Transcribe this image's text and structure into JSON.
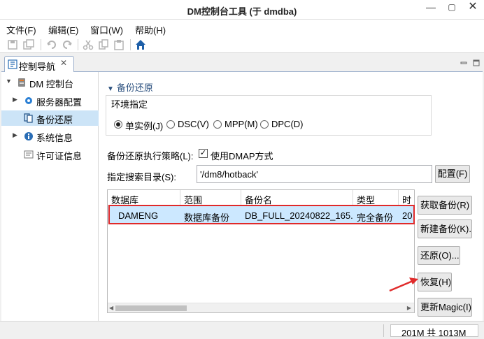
{
  "window": {
    "title": "DM控制台工具 (于 dmdba)",
    "controls": {
      "minimize": "—",
      "maximize": "▢",
      "close": "✕"
    }
  },
  "menu": {
    "items": [
      "文件(F)",
      "编辑(E)",
      "窗口(W)",
      "帮助(H)"
    ]
  },
  "toolbar": {
    "icons": [
      "save-icon",
      "save-all-icon",
      "undo-icon",
      "redo-icon",
      "cut-icon",
      "copy-icon",
      "paste-icon",
      "home-icon"
    ],
    "home_color": "#1e5fa8"
  },
  "nav_tab": {
    "label": "控制导航",
    "close": "✕"
  },
  "tree": {
    "root": "DM 控制台",
    "items": [
      {
        "label": "服务器配置",
        "icon": "gear-icon",
        "expandable": true
      },
      {
        "label": "备份还原",
        "icon": "backup-icon",
        "expandable": false,
        "selected": true
      },
      {
        "label": "系统信息",
        "icon": "info-icon",
        "expandable": true
      },
      {
        "label": "许可证信息",
        "icon": "license-icon",
        "expandable": false
      }
    ]
  },
  "main": {
    "section_title": "备份还原",
    "env_label": "环境指定",
    "env_options": [
      {
        "label": "单实例(J)",
        "selected": true
      },
      {
        "label": "DSC(V)",
        "selected": false
      },
      {
        "label": "MPP(M)",
        "selected": false
      },
      {
        "label": "DPC(D)",
        "selected": false
      }
    ],
    "strategy_label": "备份还原执行策略(L):",
    "strategy_option": "使用DMAP方式",
    "strategy_checked": true,
    "dir_label": "指定搜索目录(S):",
    "dir_value": "'/dm8/hotback'",
    "config_button": "配置(F)"
  },
  "table": {
    "columns": [
      "数据库",
      "范围",
      "备份名",
      "类型",
      "时"
    ],
    "rows": [
      [
        "DAMENG",
        "数据库备份",
        "DB_FULL_20240822_165...",
        "完全备份",
        "20"
      ]
    ]
  },
  "side_buttons": [
    "获取备份(R)",
    "新建备份(K)...",
    "还原(O)...",
    "恢复(H)",
    "更新Magic(I)"
  ],
  "status": {
    "memory": "201M 共 1013M"
  },
  "annotation_color": "#e02a2a",
  "selection_color": "#cce8ff"
}
